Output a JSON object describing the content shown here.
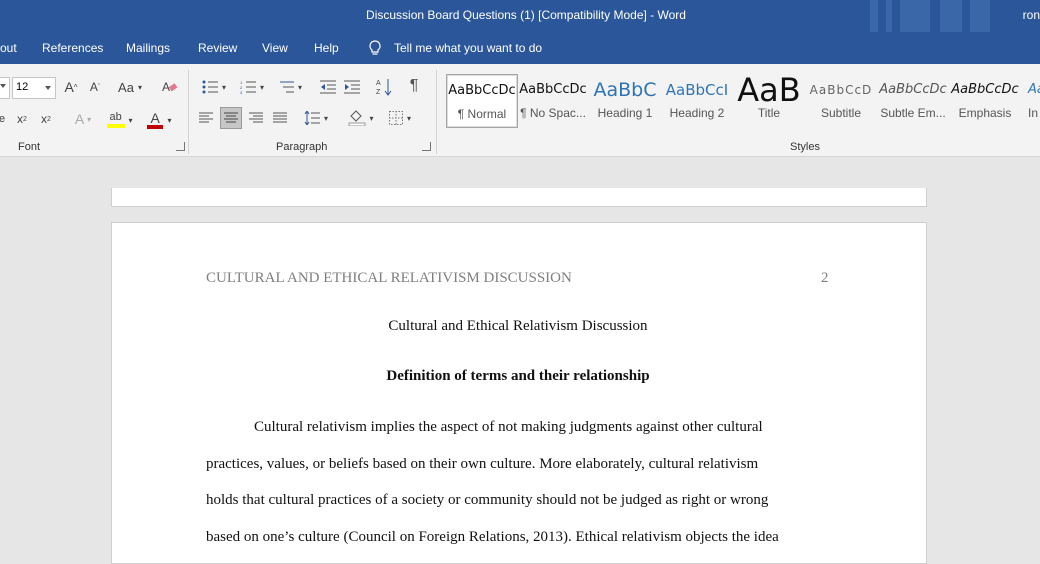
{
  "window": {
    "title": "Discussion Board Questions (1) [Compatibility Mode]  -  Word",
    "user": "ron"
  },
  "menu": {
    "tabs": [
      "out",
      "References",
      "Mailings",
      "Review",
      "View",
      "Help"
    ],
    "tell_me": "Tell me what you want to do"
  },
  "ribbon": {
    "font": {
      "size": "12",
      "case_label": "Aa",
      "group_label": "Font"
    },
    "paragraph": {
      "group_label": "Paragraph"
    },
    "styles": {
      "group_label": "Styles",
      "items": [
        {
          "sample": "AaBbCcDc",
          "label": "¶ Normal"
        },
        {
          "sample": "AaBbCcDc",
          "label": "¶ No Spac..."
        },
        {
          "sample": "AaBbC",
          "label": "Heading 1"
        },
        {
          "sample": "AaBbCcI",
          "label": "Heading 2"
        },
        {
          "sample": "AaB",
          "label": "Title"
        },
        {
          "sample": "AaBbCcD",
          "label": "Subtitle"
        },
        {
          "sample": "AaBbCcDc",
          "label": "Subtle Em..."
        },
        {
          "sample": "AaBbCcDc",
          "label": "Emphasis"
        },
        {
          "sample": "Aa",
          "label": "In"
        }
      ]
    },
    "colors": {
      "highlight": "#ffff00",
      "font_color": "#c00000",
      "accent": "#2b579a"
    }
  },
  "document": {
    "running_head": "CULTURAL AND ETHICAL RELATIVISM DISCUSSION",
    "page_number": "2",
    "title": "Cultural and Ethical Relativism Discussion",
    "heading": "Definition of terms and their relationship",
    "lines": [
      "Cultural relativism implies the aspect of not making judgments against other cultural",
      "practices, values, or beliefs based on their own culture. More elaborately, cultural relativism",
      "holds that cultural practices of a society or community should not be judged as right or wrong",
      "based on one’s culture (Council on Foreign Relations, 2013). Ethical relativism objects the idea"
    ]
  }
}
